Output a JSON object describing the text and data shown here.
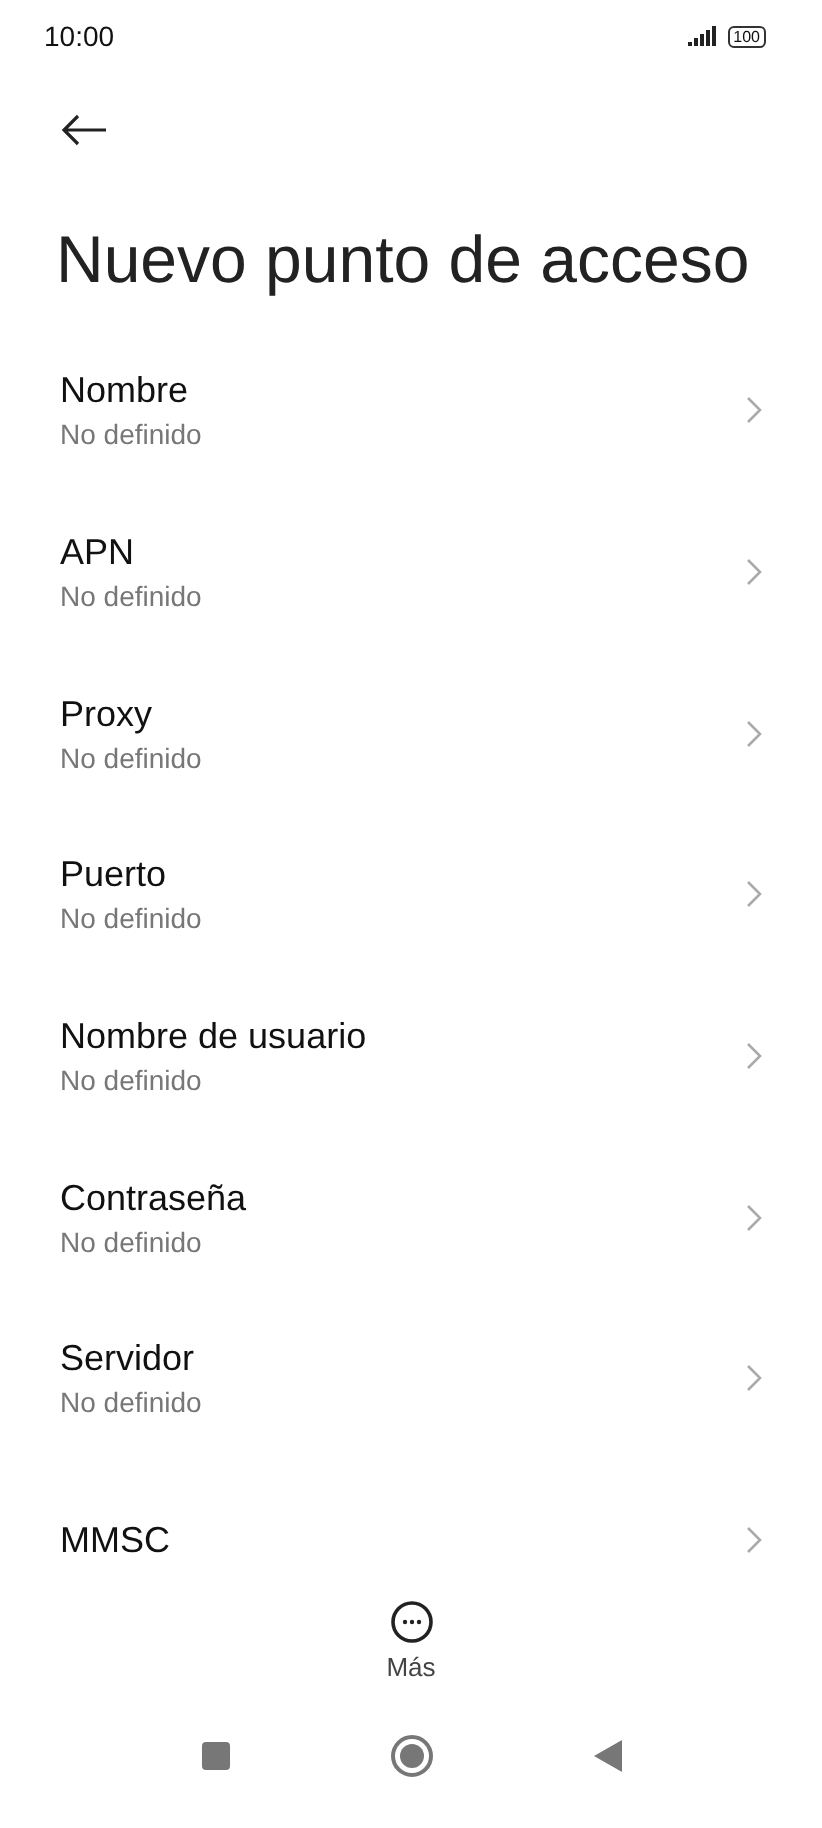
{
  "status_bar": {
    "time": "10:00",
    "battery": "100"
  },
  "title": "Nuevo punto de acceso",
  "items": [
    {
      "title": "Nombre",
      "subtitle": "No definido"
    },
    {
      "title": "APN",
      "subtitle": "No definido"
    },
    {
      "title": "Proxy",
      "subtitle": "No definido"
    },
    {
      "title": "Puerto",
      "subtitle": "No definido"
    },
    {
      "title": "Nombre de usuario",
      "subtitle": "No definido"
    },
    {
      "title": "Contraseña",
      "subtitle": "No definido"
    },
    {
      "title": "Servidor",
      "subtitle": "No definido"
    },
    {
      "title": "MMSC"
    }
  ],
  "more_button": {
    "label": "Más"
  }
}
